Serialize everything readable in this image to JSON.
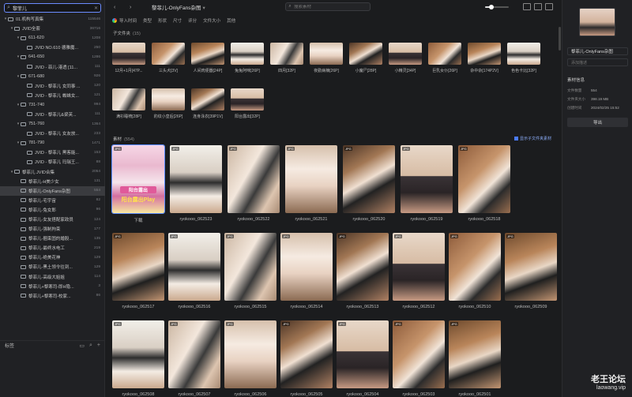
{
  "sidebar": {
    "search_value": "黎菲儿",
    "tree": [
      {
        "label": "01.机构写真集",
        "count": "115546",
        "level": 0,
        "arrow": "▾"
      },
      {
        "label": "JVID全套",
        "count": "36716",
        "level": 1,
        "arrow": "▾"
      },
      {
        "label": "611-620",
        "count": "1208",
        "level": 2,
        "arrow": "▾"
      },
      {
        "label": "JVID NO.610 德雅魔...",
        "count": "250",
        "level": 3,
        "arrow": ""
      },
      {
        "label": "641-650",
        "count": "1286",
        "level": 2,
        "arrow": "▾"
      },
      {
        "label": "JVID - 菲儿-港透 [11...",
        "count": "111",
        "level": 3,
        "arrow": ""
      },
      {
        "label": "671-680",
        "count": "926",
        "level": 2,
        "arrow": "▾"
      },
      {
        "label": "JVID - 黎菲儿 女同事 ...",
        "count": "120",
        "level": 3,
        "arrow": ""
      },
      {
        "label": "JVID - 黎菲儿 蜘蛛女...",
        "count": "121",
        "level": 3,
        "arrow": ""
      },
      {
        "label": "731-740",
        "count": "994",
        "level": 2,
        "arrow": "▾"
      },
      {
        "label": "JVID - 黎菲儿&梁芙...",
        "count": "111",
        "level": 3,
        "arrow": ""
      },
      {
        "label": "751-760",
        "count": "1364",
        "level": 2,
        "arrow": "▾"
      },
      {
        "label": "JVID - 黎菲儿 女友放...",
        "count": "233",
        "level": 3,
        "arrow": ""
      },
      {
        "label": "781-790",
        "count": "1471",
        "level": 2,
        "arrow": "▾"
      },
      {
        "label": "JVID - 黎菲儿 黑客能...",
        "count": "153",
        "level": 3,
        "arrow": ""
      },
      {
        "label": "JVID - 黎菲儿 玛瑞王...",
        "count": "88",
        "level": 3,
        "arrow": ""
      },
      {
        "label": "黎菲儿 JVID合集",
        "count": "2054",
        "level": 1,
        "arrow": "▾"
      },
      {
        "label": "黎菲儿-H美少女",
        "count": "131",
        "level": 2,
        "arrow": ""
      },
      {
        "label": "黎菲儿-OnlyFans杂图",
        "count": "554",
        "level": 2,
        "arrow": "",
        "selected": true
      },
      {
        "label": "黎菲儿-宅宇宙",
        "count": "82",
        "level": 2,
        "arrow": ""
      },
      {
        "label": "黎菲儿-兔女郎",
        "count": "96",
        "level": 2,
        "arrow": ""
      },
      {
        "label": "黎菲儿-女友搭配家政员",
        "count": "124",
        "level": 2,
        "arrow": ""
      },
      {
        "label": "黎菲儿-强制拘束",
        "count": "177",
        "level": 2,
        "arrow": ""
      },
      {
        "label": "黎菲儿-捆束固的婚股...",
        "count": "135",
        "level": 2,
        "arrow": ""
      },
      {
        "label": "黎菲儿-最终水电工",
        "count": "219",
        "level": 2,
        "arrow": ""
      },
      {
        "label": "黎菲儿-绝美花神",
        "count": "129",
        "level": 2,
        "arrow": ""
      },
      {
        "label": "黎菲儿-黑土领令往到...",
        "count": "129",
        "level": 2,
        "arrow": ""
      },
      {
        "label": "黎菲儿-高级大姐姐",
        "count": "114",
        "level": 2,
        "arrow": ""
      },
      {
        "label": "黎菲儿+黎寒司-即H隐...",
        "count": "3",
        "level": 2,
        "arrow": ""
      },
      {
        "label": "黎菲儿+黎寒司-校家...",
        "count": "86",
        "level": 2,
        "arrow": ""
      }
    ],
    "footer_label": "标签"
  },
  "topbar": {
    "title": "黎菲儿-OnlyFans杂图",
    "search_placeholder": "搜索素材",
    "zoom_percent": 25
  },
  "filters": [
    "导入时间",
    "类型",
    "形状",
    "尺寸",
    "评分",
    "文件大小",
    "其他"
  ],
  "subfolders": {
    "heading": "子文件夹",
    "count": "(15)",
    "items": [
      "12月+1月[47P...",
      "三头犬[3V]",
      "人间肉便器[24P]",
      "兔兔阿咪[26P]",
      "四月[32P]",
      "夜勤病棟[26P]",
      "小魔尸[28P]",
      "小精灵[34P]",
      "巨乳女仆[26P]",
      "杂中杂[174P2V]",
      "色色卡比[32P]",
      "满衫睡椅[28P]",
      "豹纹小皇后[26P]",
      "连身泳衣[39P1V]",
      "阳台露出[32P]"
    ]
  },
  "materials": {
    "heading": "素材",
    "count": "(554)",
    "show_sub_label": "显示子文件夹素材",
    "items": [
      {
        "name": "下载",
        "badge": "JPG",
        "cover": true,
        "cover_t1": "阳台露出",
        "cover_t2": "阳台露出Play"
      },
      {
        "name": "ryokooo_062523",
        "badge": "JPG"
      },
      {
        "name": "ryokooo_062522",
        "badge": "JPG"
      },
      {
        "name": "ryokooo_062521",
        "badge": "JPG"
      },
      {
        "name": "ryokooo_062520",
        "badge": "JPG"
      },
      {
        "name": "ryokooo_062519",
        "badge": "JPG"
      },
      {
        "name": "ryokooo_062518",
        "badge": "JPG"
      },
      {
        "name": "ryokooo_062517",
        "badge": "JPG"
      },
      {
        "name": "ryokooo_062516",
        "badge": "JPG"
      },
      {
        "name": "ryokooo_062515",
        "badge": "JPG"
      },
      {
        "name": "ryokooo_062514",
        "badge": "JPG"
      },
      {
        "name": "ryokooo_062513",
        "badge": "JPG"
      },
      {
        "name": "ryokooo_062512",
        "badge": "JPG"
      },
      {
        "name": "ryokooo_062510",
        "badge": "JPG"
      },
      {
        "name": "ryokooo_062509",
        "badge": "JPG"
      },
      {
        "name": "ryokooo_062508",
        "badge": "JPG"
      },
      {
        "name": "ryokooo_062507",
        "badge": "JPG"
      },
      {
        "name": "ryokooo_062506",
        "badge": "JPG"
      },
      {
        "name": "ryokooo_062505",
        "badge": "JPG"
      },
      {
        "name": "ryokooo_062504",
        "badge": "JPG"
      },
      {
        "name": "ryokooo_062503",
        "badge": "JPG"
      },
      {
        "name": "ryokooo_062501",
        "badge": "JPG"
      }
    ]
  },
  "inspector": {
    "name": "黎菲儿-OnlyFans杂图",
    "note_placeholder": "添加描述",
    "info_heading": "素材信息",
    "info": [
      {
        "k": "文件数量",
        "v": "554"
      },
      {
        "k": "文件夹大小",
        "v": "398.19 MB"
      },
      {
        "k": "创建时间",
        "v": "2024/02/25 15:52"
      }
    ],
    "export_label": "导出"
  },
  "watermark": {
    "line1": "老王论坛",
    "line2": "laowang.vip"
  },
  "colors": {
    "accent": "#5b8cff",
    "background": "#1b1c1e",
    "sidebar": "#202124"
  }
}
